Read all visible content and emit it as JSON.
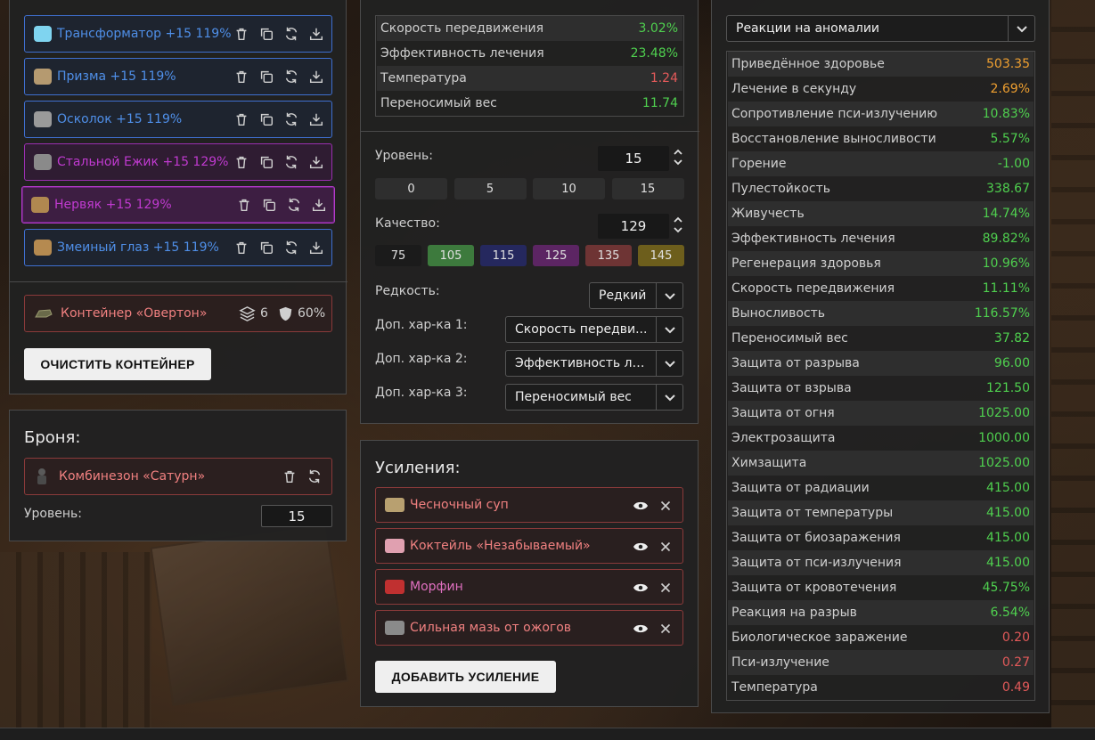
{
  "artifacts": [
    {
      "name": "Трансформатор +15 119%",
      "color": "blue",
      "icon_color": "#7fd4f0"
    },
    {
      "name": "Призма +15 119%",
      "color": "blue",
      "icon_color": "#b59a70"
    },
    {
      "name": "Осколок +15 119%",
      "color": "blue",
      "icon_color": "#9a9a9a"
    },
    {
      "name": "Стальной Ежик +15 129%",
      "color": "purple",
      "icon_color": "#8a8a8a"
    },
    {
      "name": "Нервяк +15 129%",
      "color": "purple",
      "icon_color": "#b08850"
    },
    {
      "name": "Змеиный глаз +15 119%",
      "color": "blue",
      "icon_color": "#b58a50"
    }
  ],
  "container": {
    "name": "Контейнер «Овертон»",
    "slots": "6",
    "protection": "60%",
    "clear_button": "ОЧИСТИТЬ КОНТЕЙНЕР"
  },
  "armor": {
    "heading": "Броня:",
    "name": "Комбинезон «Сатурн»",
    "level_label": "Уровень:",
    "level_value": "15"
  },
  "artifact_stats": [
    {
      "name": "Скорость передвижения",
      "value": "3.02%",
      "tone": "green"
    },
    {
      "name": "Эффективность лечения",
      "value": "23.48%",
      "tone": "green"
    },
    {
      "name": "Температура",
      "value": "1.24",
      "tone": "red"
    },
    {
      "name": "Переносимый вес",
      "value": "11.74",
      "tone": "green"
    }
  ],
  "editor": {
    "level_label": "Уровень:",
    "level_value": "15",
    "level_presets": [
      "0",
      "5",
      "10",
      "15"
    ],
    "quality_label": "Качество:",
    "quality_value": "129",
    "quality_presets": [
      {
        "label": "75",
        "color": "#1b1b1b"
      },
      {
        "label": "105",
        "color": "#3d7a3d"
      },
      {
        "label": "115",
        "color": "#25285e"
      },
      {
        "label": "125",
        "color": "#5c2563"
      },
      {
        "label": "135",
        "color": "#6e3434"
      },
      {
        "label": "145",
        "color": "#6d5e1c"
      }
    ],
    "rarity_label": "Редкость:",
    "rarity_value": "Редкий",
    "extra1_label": "Доп. хар-ка 1:",
    "extra1_value": "Скорость передви...",
    "extra2_label": "Доп. хар-ка 2:",
    "extra2_value": "Эффективность ле...",
    "extra3_label": "Доп. хар-ка 3:",
    "extra3_value": "Переносимый вес"
  },
  "boosts": {
    "heading": "Усиления:",
    "items": [
      {
        "name": "Чесночный суп",
        "style": "red",
        "icon_color": "#b8a070"
      },
      {
        "name": "Коктейль «Незабываемый»",
        "style": "red",
        "icon_color": "#e0a0b0"
      },
      {
        "name": "Морфин",
        "style": "pink",
        "icon_color": "#c03030"
      },
      {
        "name": "Сильная мазь от ожогов",
        "style": "red",
        "icon_color": "#8a8a8a"
      }
    ],
    "add_button": "ДОБАВИТЬ УСИЛЕНИЕ"
  },
  "summary": {
    "filter_value": "Реакции на аномалии",
    "rows": [
      {
        "name": "Приведённое здоровье",
        "value": "503.35",
        "tone": "orange"
      },
      {
        "name": "Лечение в секунду",
        "value": "2.69%",
        "tone": "orange"
      },
      {
        "name": "Сопротивление пси-излучению",
        "value": "10.83%",
        "tone": "green"
      },
      {
        "name": "Восстановление выносливости",
        "value": "5.57%",
        "tone": "green"
      },
      {
        "name": "Горение",
        "value": "-1.00",
        "tone": "green"
      },
      {
        "name": "Пулестойкость",
        "value": "338.67",
        "tone": "green"
      },
      {
        "name": "Живучесть",
        "value": "14.74%",
        "tone": "green"
      },
      {
        "name": "Эффективность лечения",
        "value": "89.82%",
        "tone": "green"
      },
      {
        "name": "Регенерация здоровья",
        "value": "10.96%",
        "tone": "green"
      },
      {
        "name": "Скорость передвижения",
        "value": "11.11%",
        "tone": "green"
      },
      {
        "name": "Выносливость",
        "value": "116.57%",
        "tone": "green"
      },
      {
        "name": "Переносимый вес",
        "value": "37.82",
        "tone": "green"
      },
      {
        "name": "Защита от разрыва",
        "value": "96.00",
        "tone": "green"
      },
      {
        "name": "Защита от взрыва",
        "value": "121.50",
        "tone": "green"
      },
      {
        "name": "Защита от огня",
        "value": "1025.00",
        "tone": "green"
      },
      {
        "name": "Электрозащита",
        "value": "1000.00",
        "tone": "green"
      },
      {
        "name": "Химзащита",
        "value": "1025.00",
        "tone": "green"
      },
      {
        "name": "Защита от радиации",
        "value": "415.00",
        "tone": "green"
      },
      {
        "name": "Защита от температуры",
        "value": "415.00",
        "tone": "green"
      },
      {
        "name": "Защита от биозаражения",
        "value": "415.00",
        "tone": "green"
      },
      {
        "name": "Защита от пси-излучения",
        "value": "415.00",
        "tone": "green"
      },
      {
        "name": "Защита от кровотечения",
        "value": "45.75%",
        "tone": "green"
      },
      {
        "name": "Реакция на разрыв",
        "value": "6.54%",
        "tone": "green"
      },
      {
        "name": "Биологическое заражение",
        "value": "0.20",
        "tone": "red"
      },
      {
        "name": "Пси-излучение",
        "value": "0.27",
        "tone": "red"
      },
      {
        "name": "Температура",
        "value": "0.49",
        "tone": "red"
      }
    ]
  }
}
